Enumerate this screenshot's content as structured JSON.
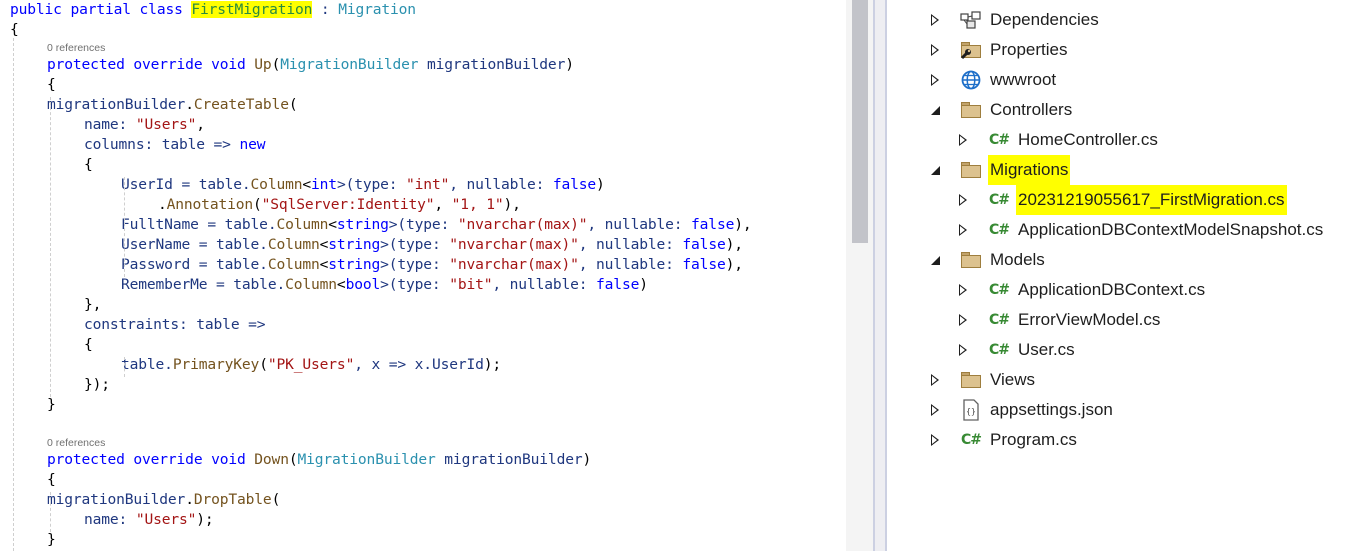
{
  "editor": {
    "lines": [
      {
        "indent": 0,
        "tokens": [
          {
            "t": "public partial class ",
            "c": "kw"
          },
          {
            "t": "FirstMigration",
            "c": "cls hl"
          },
          {
            "t": " : ",
            "c": "ident"
          },
          {
            "t": "Migration",
            "c": "type"
          }
        ]
      },
      {
        "indent": 0,
        "tokens": [
          {
            "t": "{",
            "c": "plain"
          }
        ]
      },
      {
        "indent": 1,
        "tokens": [
          {
            "t": "protected override void ",
            "c": "kw"
          },
          {
            "t": "Up",
            "c": "meth"
          },
          {
            "t": "(",
            "c": "plain"
          },
          {
            "t": "MigrationBuilder",
            "c": "type"
          },
          {
            "t": " migrationBuilder",
            "c": "ident"
          },
          {
            "t": ")",
            "c": "plain"
          }
        ]
      },
      {
        "indent": 1,
        "tokens": [
          {
            "t": "{",
            "c": "plain"
          }
        ]
      },
      {
        "indent": 2,
        "tokens": [
          {
            "t": "migrationBuilder",
            "c": "ident"
          },
          {
            "t": ".",
            "c": "plain"
          },
          {
            "t": "CreateTable",
            "c": "meth"
          },
          {
            "t": "(",
            "c": "plain"
          }
        ]
      },
      {
        "indent": 3,
        "tokens": [
          {
            "t": "name: ",
            "c": "ident"
          },
          {
            "t": "\"Users\"",
            "c": "str"
          },
          {
            "t": ",",
            "c": "plain"
          }
        ]
      },
      {
        "indent": 3,
        "tokens": [
          {
            "t": "columns: table => ",
            "c": "ident"
          },
          {
            "t": "new",
            "c": "kw"
          }
        ]
      },
      {
        "indent": 3,
        "tokens": [
          {
            "t": "{",
            "c": "plain"
          }
        ]
      },
      {
        "indent": 4,
        "tokens": [
          {
            "t": "UserId = table.",
            "c": "ident"
          },
          {
            "t": "Column",
            "c": "meth"
          },
          {
            "t": "<",
            "c": "plain"
          },
          {
            "t": "int",
            "c": "kw"
          },
          {
            "t": ">(type: ",
            "c": "ident"
          },
          {
            "t": "\"int\"",
            "c": "str"
          },
          {
            "t": ", nullable: ",
            "c": "ident"
          },
          {
            "t": "false",
            "c": "kw"
          },
          {
            "t": ")",
            "c": "plain"
          }
        ]
      },
      {
        "indent": 5,
        "tokens": [
          {
            "t": ".",
            "c": "plain"
          },
          {
            "t": "Annotation",
            "c": "meth"
          },
          {
            "t": "(",
            "c": "plain"
          },
          {
            "t": "\"SqlServer:Identity\"",
            "c": "str"
          },
          {
            "t": ", ",
            "c": "plain"
          },
          {
            "t": "\"1, 1\"",
            "c": "str"
          },
          {
            "t": "),",
            "c": "plain"
          }
        ]
      },
      {
        "indent": 4,
        "tokens": [
          {
            "t": "FulltName = table.",
            "c": "ident"
          },
          {
            "t": "Column",
            "c": "meth"
          },
          {
            "t": "<",
            "c": "plain"
          },
          {
            "t": "string",
            "c": "kw"
          },
          {
            "t": ">(type: ",
            "c": "ident"
          },
          {
            "t": "\"nvarchar(max)\"",
            "c": "str"
          },
          {
            "t": ", nullable: ",
            "c": "ident"
          },
          {
            "t": "false",
            "c": "kw"
          },
          {
            "t": "),",
            "c": "plain"
          }
        ]
      },
      {
        "indent": 4,
        "tokens": [
          {
            "t": "UserName = table.",
            "c": "ident"
          },
          {
            "t": "Column",
            "c": "meth"
          },
          {
            "t": "<",
            "c": "plain"
          },
          {
            "t": "string",
            "c": "kw"
          },
          {
            "t": ">(type: ",
            "c": "ident"
          },
          {
            "t": "\"nvarchar(max)\"",
            "c": "str"
          },
          {
            "t": ", nullable: ",
            "c": "ident"
          },
          {
            "t": "false",
            "c": "kw"
          },
          {
            "t": "),",
            "c": "plain"
          }
        ]
      },
      {
        "indent": 4,
        "tokens": [
          {
            "t": "Password = table.",
            "c": "ident"
          },
          {
            "t": "Column",
            "c": "meth"
          },
          {
            "t": "<",
            "c": "plain"
          },
          {
            "t": "string",
            "c": "kw"
          },
          {
            "t": ">(type: ",
            "c": "ident"
          },
          {
            "t": "\"nvarchar(max)\"",
            "c": "str"
          },
          {
            "t": ", nullable: ",
            "c": "ident"
          },
          {
            "t": "false",
            "c": "kw"
          },
          {
            "t": "),",
            "c": "plain"
          }
        ]
      },
      {
        "indent": 4,
        "tokens": [
          {
            "t": "RememberMe = table.",
            "c": "ident"
          },
          {
            "t": "Column",
            "c": "meth"
          },
          {
            "t": "<",
            "c": "plain"
          },
          {
            "t": "bool",
            "c": "kw"
          },
          {
            "t": ">(type: ",
            "c": "ident"
          },
          {
            "t": "\"bit\"",
            "c": "str"
          },
          {
            "t": ", nullable: ",
            "c": "ident"
          },
          {
            "t": "false",
            "c": "kw"
          },
          {
            "t": ")",
            "c": "plain"
          }
        ]
      },
      {
        "indent": 3,
        "tokens": [
          {
            "t": "},",
            "c": "plain"
          }
        ]
      },
      {
        "indent": 3,
        "tokens": [
          {
            "t": "constraints: table =>",
            "c": "ident"
          }
        ]
      },
      {
        "indent": 3,
        "tokens": [
          {
            "t": "{",
            "c": "plain"
          }
        ]
      },
      {
        "indent": 4,
        "tokens": [
          {
            "t": "table.",
            "c": "ident"
          },
          {
            "t": "PrimaryKey",
            "c": "meth"
          },
          {
            "t": "(",
            "c": "plain"
          },
          {
            "t": "\"PK_Users\"",
            "c": "str"
          },
          {
            "t": ", x => x.UserId",
            "c": "ident"
          },
          {
            "t": ");",
            "c": "plain"
          }
        ]
      },
      {
        "indent": 3,
        "tokens": [
          {
            "t": "});",
            "c": "plain"
          }
        ]
      },
      {
        "indent": 1,
        "tokens": [
          {
            "t": "}",
            "c": "plain"
          }
        ]
      },
      {
        "indent": 1,
        "tokens": [
          {
            "t": "protected override void ",
            "c": "kw"
          },
          {
            "t": "Down",
            "c": "meth"
          },
          {
            "t": "(",
            "c": "plain"
          },
          {
            "t": "MigrationBuilder",
            "c": "type"
          },
          {
            "t": " migrationBuilder",
            "c": "ident"
          },
          {
            "t": ")",
            "c": "plain"
          }
        ]
      },
      {
        "indent": 1,
        "tokens": [
          {
            "t": "{",
            "c": "plain"
          }
        ]
      },
      {
        "indent": 2,
        "tokens": [
          {
            "t": "migrationBuilder",
            "c": "ident"
          },
          {
            "t": ".",
            "c": "plain"
          },
          {
            "t": "DropTable",
            "c": "meth"
          },
          {
            "t": "(",
            "c": "plain"
          }
        ]
      },
      {
        "indent": 3,
        "tokens": [
          {
            "t": "name: ",
            "c": "ident"
          },
          {
            "t": "\"Users\"",
            "c": "str"
          },
          {
            "t": ");",
            "c": "plain"
          }
        ]
      },
      {
        "indent": 1,
        "tokens": [
          {
            "t": "}",
            "c": "plain"
          }
        ]
      }
    ],
    "codelens": {
      "up_references": "0 references",
      "down_references": "0 references"
    },
    "highlight_color": "#ffff00"
  },
  "solution_explorer": {
    "items": [
      {
        "label": "Dependencies",
        "icon": "dependencies-icon",
        "level": 0,
        "expander": "collapsed",
        "highlight": false
      },
      {
        "label": "Properties",
        "icon": "properties-folder-icon",
        "level": 0,
        "expander": "collapsed",
        "highlight": false
      },
      {
        "label": "wwwroot",
        "icon": "globe-icon",
        "level": 0,
        "expander": "collapsed",
        "highlight": false
      },
      {
        "label": "Controllers",
        "icon": "folder-icon",
        "level": 0,
        "expander": "expanded",
        "highlight": false
      },
      {
        "label": "HomeController.cs",
        "icon": "csharp-file-icon",
        "level": 1,
        "expander": "collapsed",
        "highlight": false
      },
      {
        "label": "Migrations",
        "icon": "folder-icon",
        "level": 0,
        "expander": "expanded",
        "highlight": true
      },
      {
        "label": "20231219055617_FirstMigration.cs",
        "icon": "csharp-file-icon",
        "level": 1,
        "expander": "collapsed",
        "highlight": true
      },
      {
        "label": "ApplicationDBContextModelSnapshot.cs",
        "icon": "csharp-file-icon",
        "level": 1,
        "expander": "collapsed",
        "highlight": false
      },
      {
        "label": "Models",
        "icon": "folder-icon",
        "level": 0,
        "expander": "expanded",
        "highlight": false
      },
      {
        "label": "ApplicationDBContext.cs",
        "icon": "csharp-file-icon",
        "level": 1,
        "expander": "collapsed",
        "highlight": false
      },
      {
        "label": "ErrorViewModel.cs",
        "icon": "csharp-file-icon",
        "level": 1,
        "expander": "collapsed",
        "highlight": false
      },
      {
        "label": "User.cs",
        "icon": "csharp-file-icon",
        "level": 1,
        "expander": "collapsed",
        "highlight": false
      },
      {
        "label": "Views",
        "icon": "folder-icon",
        "level": 0,
        "expander": "collapsed",
        "highlight": false
      },
      {
        "label": "appsettings.json",
        "icon": "json-file-icon",
        "level": 0,
        "expander": "collapsed",
        "highlight": false
      },
      {
        "label": "Program.cs",
        "icon": "csharp-file-icon",
        "level": 0,
        "expander": "collapsed",
        "highlight": false
      }
    ],
    "csharp_glyph": "C#",
    "json_glyph": "{}"
  }
}
